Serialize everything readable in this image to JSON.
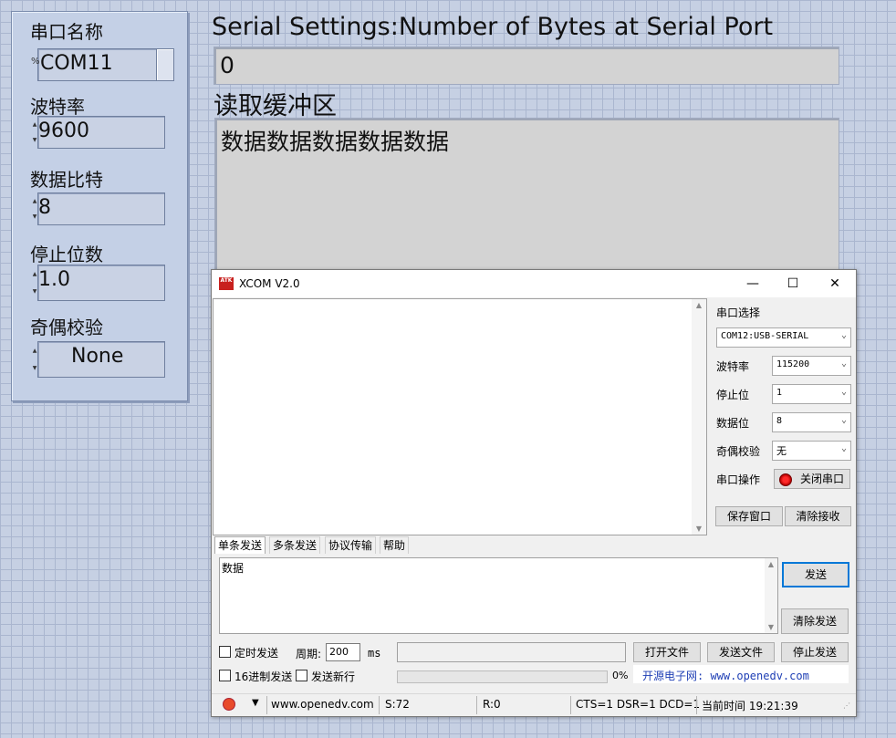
{
  "lv_panel": {
    "port_name_label": "串口名称",
    "port_name_value": "COM11",
    "port_prefix": "%",
    "baud_label": "波特率",
    "baud_value": "9600",
    "databits_label": "数据比特",
    "databits_value": "8",
    "stopbits_label": "停止位数",
    "stopbits_value": "1.0",
    "parity_label": "奇偶校验",
    "parity_value": "None"
  },
  "lv_main": {
    "bytes_title": "Serial Settings:Number of Bytes at Serial Port",
    "bytes_value": "0",
    "buffer_title": "读取缓冲区",
    "buffer_value": "数据数据数据数据数据"
  },
  "xcom": {
    "title": "XCOM V2.0",
    "logo_text": "ATK",
    "controls": {
      "minimize": "—",
      "maximize": "☐",
      "close": "✕"
    },
    "right_panel": {
      "port_select_label": "串口选择",
      "port_select_value": "COM12:USB-SERIAL",
      "baud_label": "波特率",
      "baud_value": "115200",
      "stop_label": "停止位",
      "stop_value": "1",
      "data_label": "数据位",
      "data_value": "8",
      "parity_label": "奇偶校验",
      "parity_value": "无",
      "op_label": "串口操作",
      "close_port_label": "关闭串口",
      "save_window_label": "保存窗口",
      "clear_rx_label": "清除接收"
    },
    "tabs": [
      "单条发送",
      "多条发送",
      "协议传输",
      "帮助"
    ],
    "send_text": "数据",
    "send_button": "发送",
    "clear_send_button": "清除发送",
    "timed_send_label": "定时发送",
    "period_label": "周期:",
    "period_value": "200",
    "period_unit": "ms",
    "open_file_button": "打开文件",
    "send_file_button": "发送文件",
    "stop_send_button": "停止发送",
    "hex_send_label": "16进制发送",
    "newline_label": "发送新行",
    "progress_text": "0%",
    "progress_value": 0,
    "site_text": "开源电子网: www.openedv.com",
    "status": {
      "url": "www.openedv.com",
      "sent": "S:72",
      "recv": "R:0",
      "lines": "CTS=1 DSR=1 DCD=1",
      "time": "当前时间 19:21:39"
    },
    "accent_color": "#0078d7",
    "site_color": "#1f3fb5"
  }
}
